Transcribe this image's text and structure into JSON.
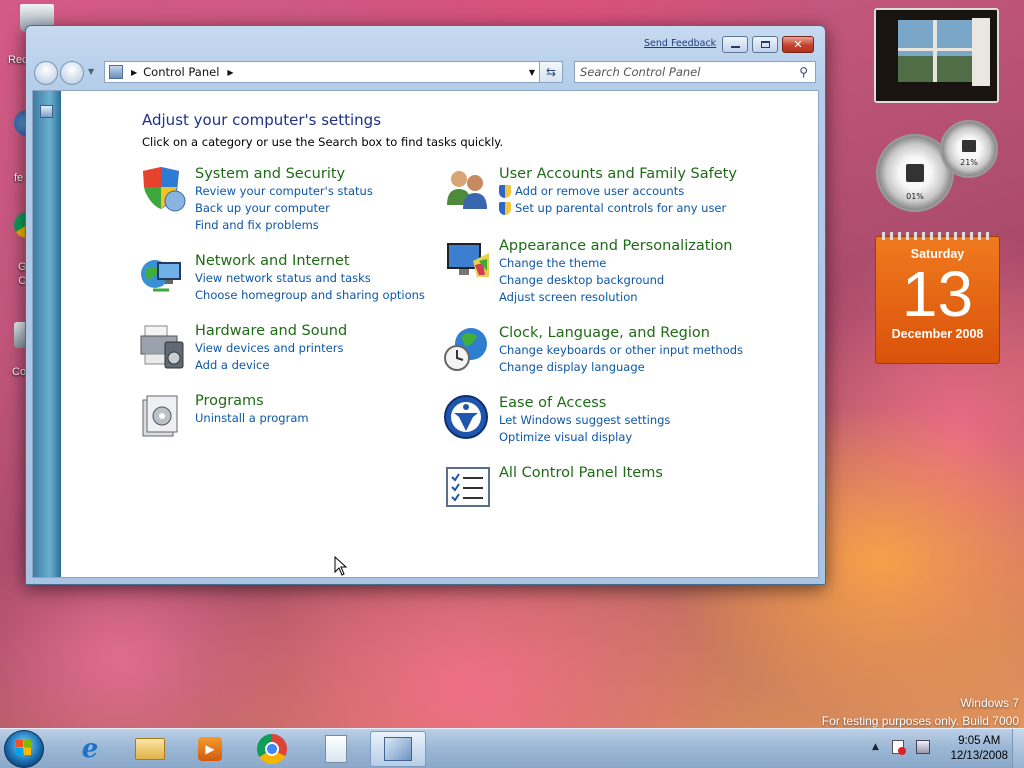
{
  "desktop": {
    "icons": [
      {
        "label": "Rec"
      },
      {
        "label": "fe"
      },
      {
        "label": "G\nC"
      },
      {
        "label": "Co"
      }
    ],
    "watermark_line1": "Windows 7",
    "watermark_line2": "For testing purposes only. Build 7000"
  },
  "window": {
    "send_feedback": "Send Feedback",
    "breadcrumb": "Control Panel",
    "search_placeholder": "Search Control Panel",
    "heading": "Adjust your computer's settings",
    "subheading": "Click on a category or use the Search box to find tasks quickly.",
    "categories": [
      {
        "title": "System and Security",
        "links": [
          "Review your computer's status",
          "Back up your computer",
          "Find and fix problems"
        ],
        "icon": "shield-icon"
      },
      {
        "title": "Network and Internet",
        "links": [
          "View network status and tasks",
          "Choose homegroup and sharing options"
        ],
        "icon": "network-icon"
      },
      {
        "title": "Hardware and Sound",
        "links": [
          "View devices and printers",
          "Add a device"
        ],
        "icon": "printer-icon"
      },
      {
        "title": "Programs",
        "links": [
          "Uninstall a program"
        ],
        "icon": "programs-icon"
      },
      {
        "title": "User Accounts and Family Safety",
        "links": [
          "Add or remove user accounts",
          "Set up parental controls for any user"
        ],
        "icon": "users-icon"
      },
      {
        "title": "Appearance and Personalization",
        "links": [
          "Change the theme",
          "Change desktop background",
          "Adjust screen resolution"
        ],
        "icon": "monitor-icon"
      },
      {
        "title": "Clock, Language, and Region",
        "links": [
          "Change keyboards or other input methods",
          "Change display language"
        ],
        "icon": "globe-clock-icon"
      },
      {
        "title": "Ease of Access",
        "links": [
          "Let Windows suggest settings",
          "Optimize visual display"
        ],
        "icon": "ease-of-access-icon"
      },
      {
        "title": "All Control Panel Items",
        "links": [],
        "icon": "list-icon"
      }
    ]
  },
  "gadgets": {
    "cpu_percent_label": "01%",
    "memory_percent_label": "21%",
    "calendar_day": "Saturday",
    "calendar_date": "13",
    "calendar_month": "December 2008"
  },
  "taskbar": {
    "items": [
      "start-button",
      "internet-explorer-icon",
      "explorer-icon",
      "media-player-icon",
      "chrome-icon",
      "document-icon",
      "control-panel-icon"
    ],
    "time": "9:05 AM",
    "date": "12/13/2008"
  },
  "colors": {
    "category_title": "#1e6b16",
    "link": "#0d57a6",
    "heading": "#1e3287",
    "calendar": "#e3620f"
  }
}
